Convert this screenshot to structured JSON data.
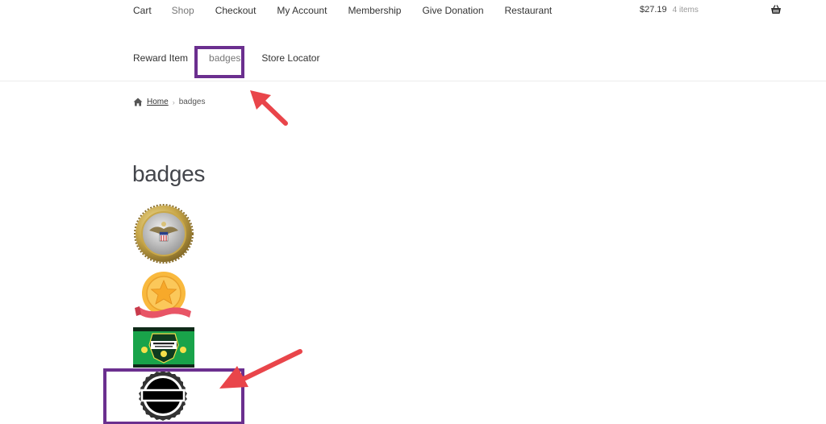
{
  "nav": {
    "row1": [
      "Cart",
      "Shop",
      "Checkout",
      "My Account",
      "Membership",
      "Give Donation",
      "Restaurant"
    ],
    "row2": [
      "Reward Item",
      "badges",
      "Store Locator"
    ]
  },
  "cart": {
    "amount": "$27.19",
    "count": "4 items",
    "icon": "basket-icon"
  },
  "breadcrumb": {
    "home": "Home",
    "separator": "›",
    "current": "badges"
  },
  "page": {
    "title": "badges"
  },
  "badges": [
    {
      "icon": "military-seal-badge"
    },
    {
      "icon": "gold-star-ribbon-badge"
    },
    {
      "icon": "green-badges-poster"
    },
    {
      "icon": "black-scalloped-badge"
    }
  ],
  "colors": {
    "highlight": "#6b2f8f",
    "arrow": "#e9454a",
    "text": "#43454b"
  }
}
